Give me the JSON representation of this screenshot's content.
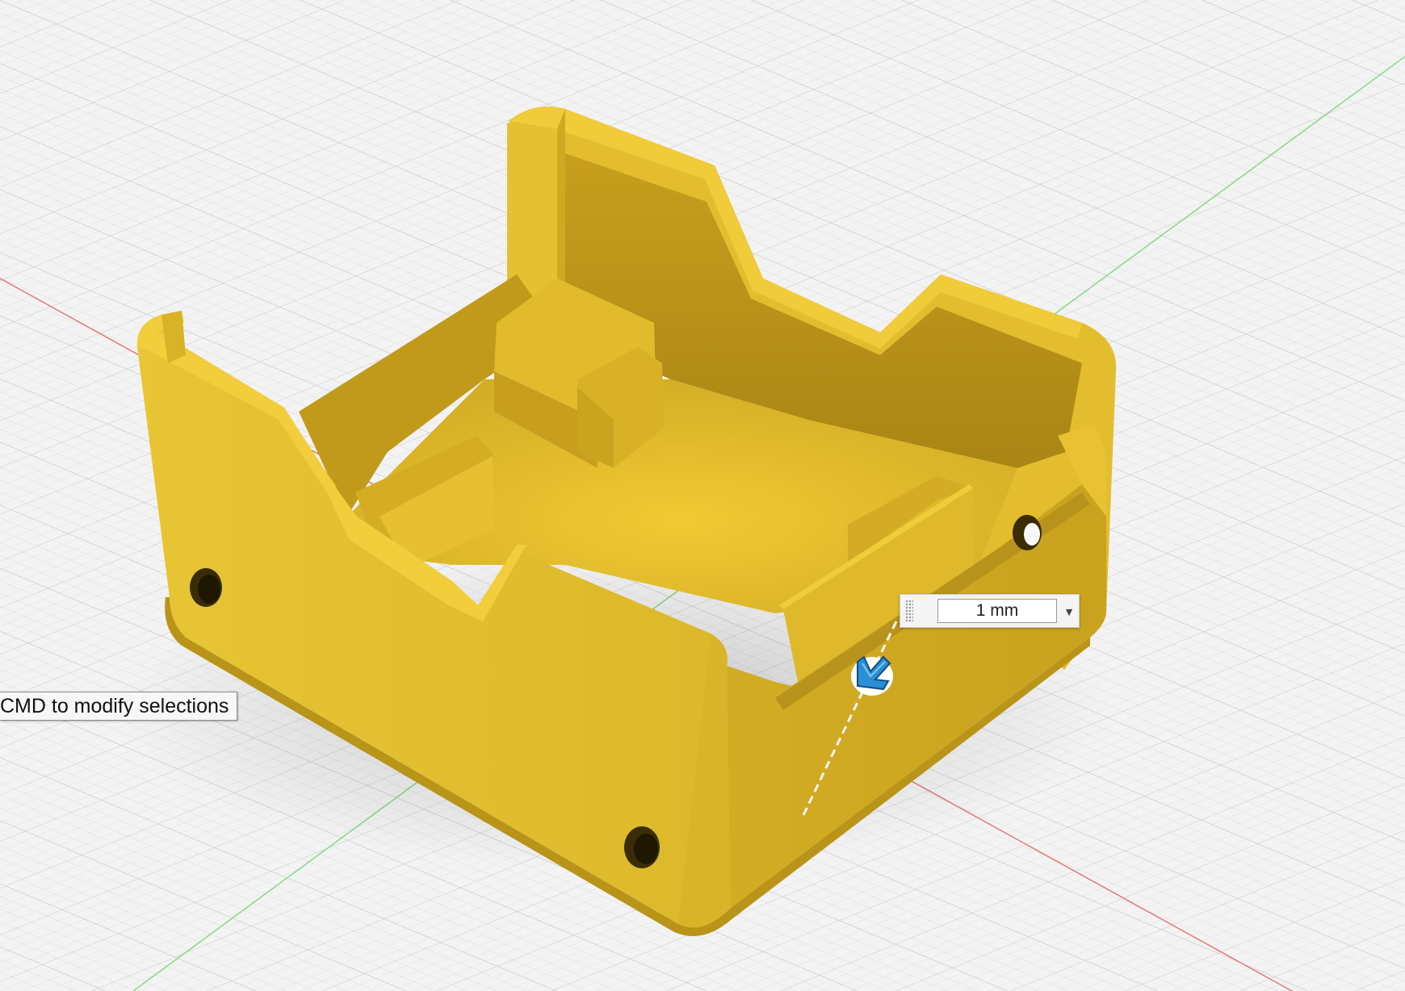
{
  "viewport": {
    "background": "#f3f3f3",
    "grid_color": "#d9d9d9",
    "x_axis_color": "#e07272",
    "y_axis_color": "#7fd67f",
    "model_color": "#e6c233"
  },
  "tooltip": {
    "text": "CMD to modify selections"
  },
  "dimension_input": {
    "value": "1 mm",
    "dropdown_icon": "chevron-down-icon"
  },
  "manipulator": {
    "icon": "offset-arrow-icon",
    "color": "#2a8fd4"
  }
}
